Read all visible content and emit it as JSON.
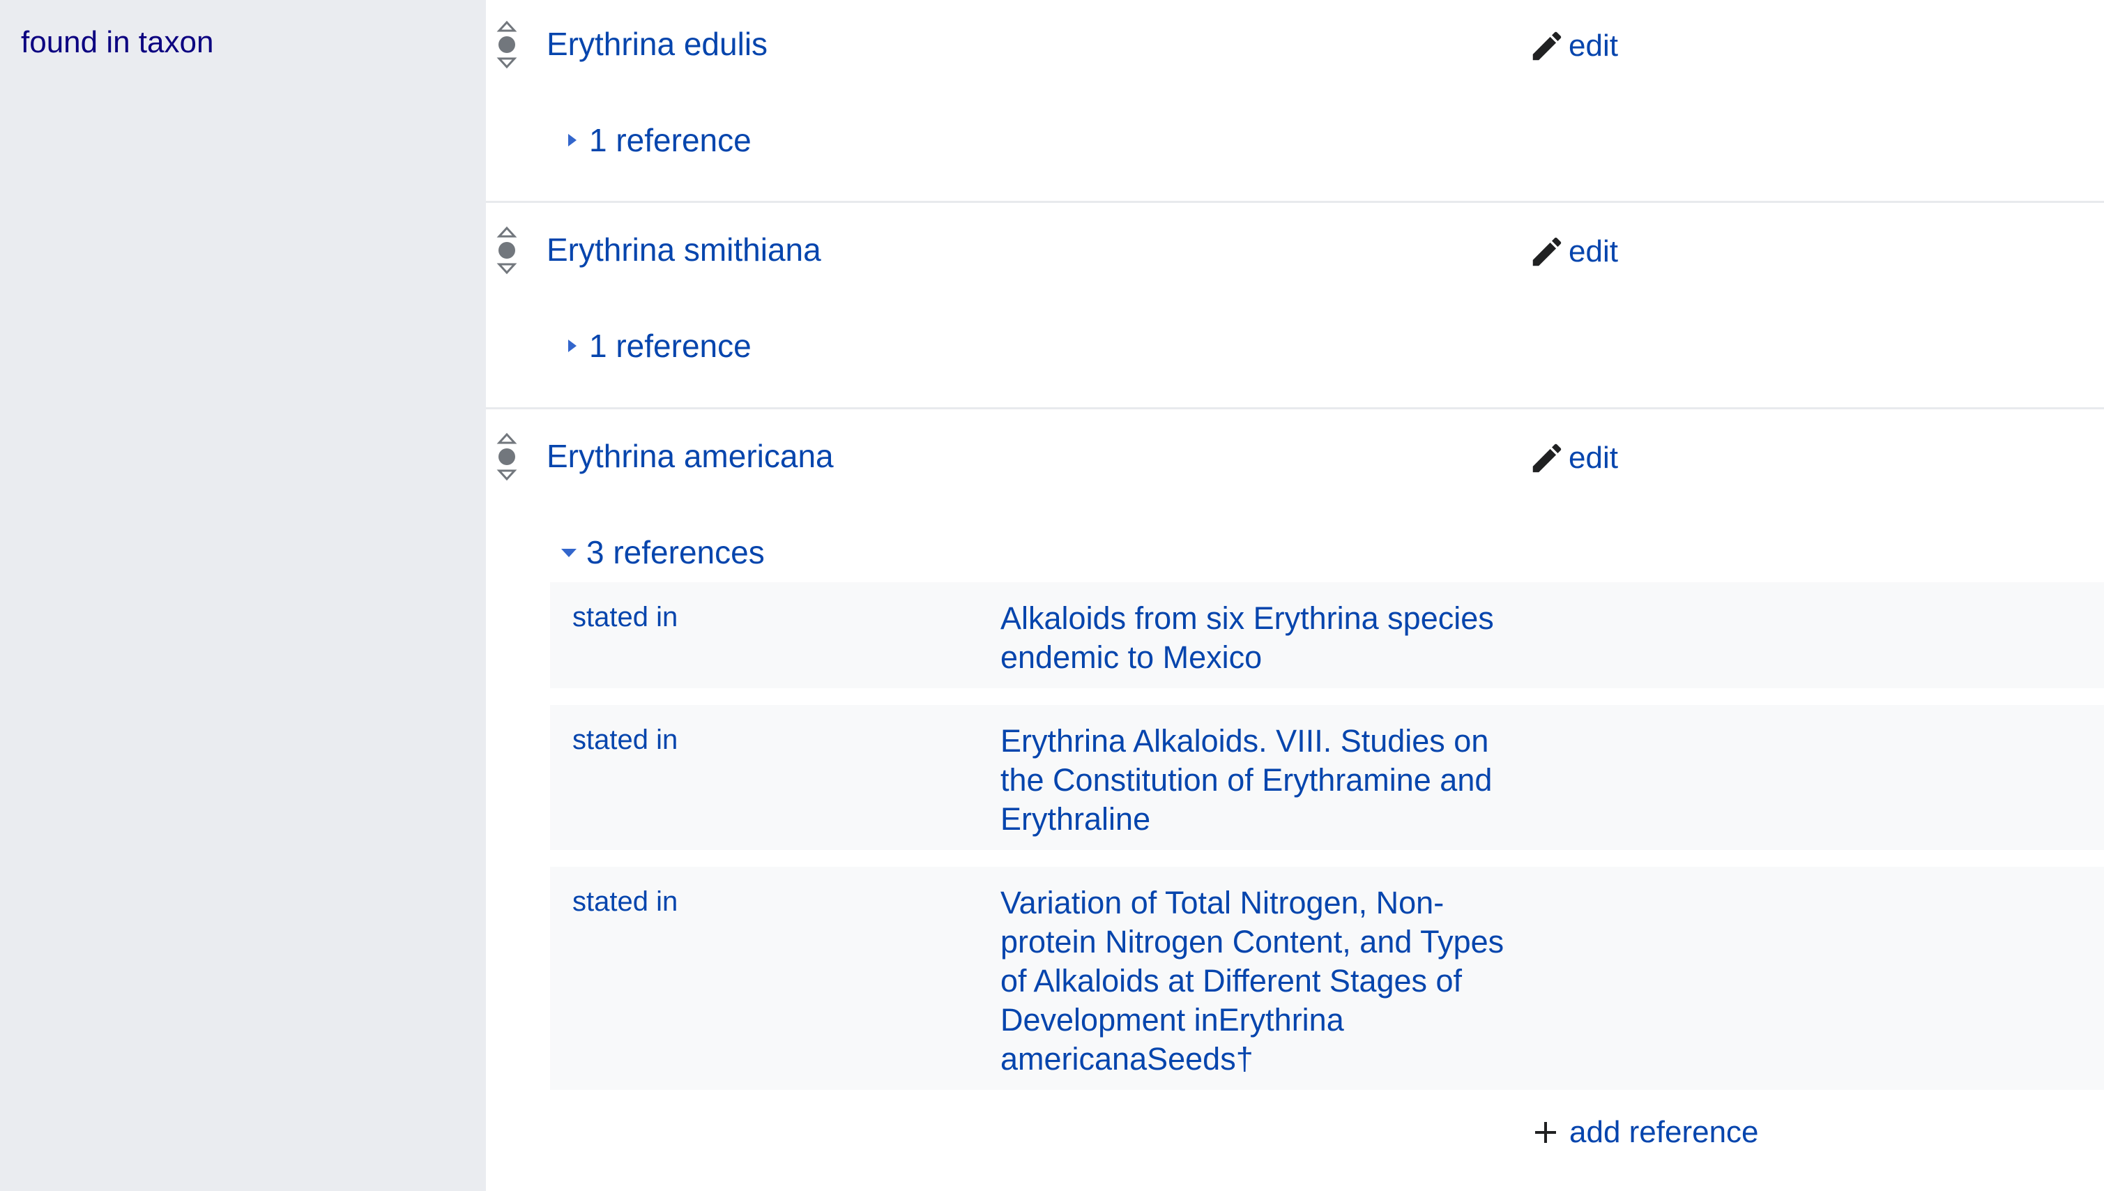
{
  "property": {
    "label": "found in taxon"
  },
  "statements": [
    {
      "value": "Erythrina edulis",
      "edit_label": "edit",
      "references_toggle": "1 reference",
      "expanded": false
    },
    {
      "value": "Erythrina smithiana",
      "edit_label": "edit",
      "references_toggle": "1 reference",
      "expanded": false
    },
    {
      "value": "Erythrina americana",
      "edit_label": "edit",
      "references_toggle": "3 references",
      "expanded": true,
      "references": [
        {
          "property": "stated in",
          "value": "Alkaloids from six Erythrina species endemic to Mexico"
        },
        {
          "property": "stated in",
          "value": "Erythrina Alkaloids. VIII. Studies on the Constitution of Erythramine and Erythraline"
        },
        {
          "property": "stated in",
          "value": "Variation of Total Nitrogen, Non-protein Nitrogen Content, and Types of Alkaloids at Different Stages of Development inErythrina americanaSeeds†"
        }
      ],
      "add_reference_label": "add reference"
    }
  ],
  "colors": {
    "link": "#0645ad",
    "sidebar_bg": "#eaecf0",
    "reference_bg": "#f8f9fa",
    "separator": "#e8eaed"
  },
  "icons": {
    "rank": "rank-selector-icon",
    "edit": "pencil-icon",
    "collapsed": "triangle-right-icon",
    "expanded": "triangle-down-icon",
    "add": "plus-icon"
  }
}
